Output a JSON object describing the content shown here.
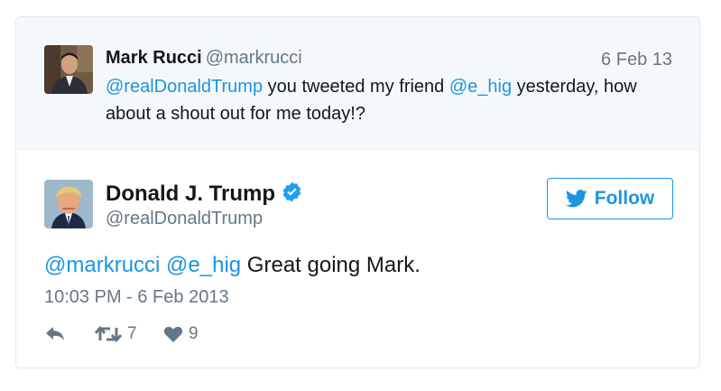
{
  "parent_tweet": {
    "name": "Mark Rucci",
    "handle": "@markrucci",
    "date": "6 Feb 13",
    "mention1": "@realDonaldTrump",
    "text1": " you tweeted my friend ",
    "mention2": "@e_hig",
    "text2": " yesterday, how about a shout out for me today!?"
  },
  "main_tweet": {
    "name": "Donald J. Trump",
    "handle": "@realDonaldTrump",
    "verified_icon": "verified-badge-icon",
    "mention1": "@markrucci",
    "mention2": "@e_hig",
    "text": " Great going Mark.",
    "timestamp": "10:03 PM - 6 Feb 2013"
  },
  "follow_button": {
    "label": "Follow",
    "icon": "bird-icon"
  },
  "actions": {
    "reply_icon": "reply-icon",
    "retweet_icon": "retweet-icon",
    "retweet_count": "7",
    "like_icon": "heart-icon",
    "like_count": "9"
  },
  "colors": {
    "link": "#1b95e0",
    "muted": "#657786",
    "text": "#14171a",
    "parent_background": "#f5f8fa",
    "border": "#e1e8ed"
  }
}
